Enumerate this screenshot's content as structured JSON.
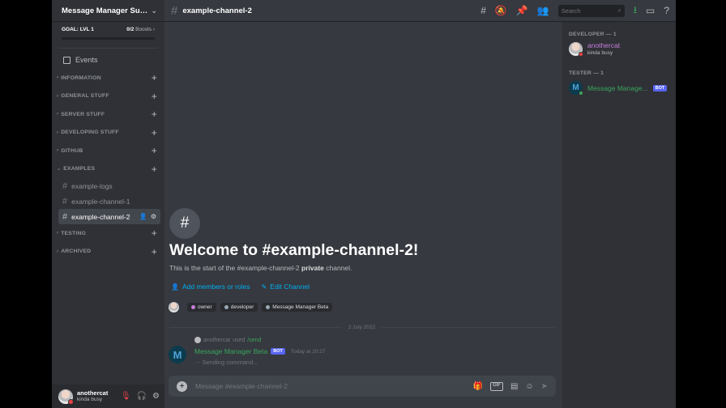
{
  "server": {
    "name": "Message Manager Supp...",
    "boost_goal": "GOAL: LVL 1",
    "boost_count": "0/2",
    "boost_word": "Boosts",
    "events_label": "Events"
  },
  "categories": [
    {
      "name": "INFORMATION"
    },
    {
      "name": "GENERAL STUFF"
    },
    {
      "name": "SERVER STUFF"
    },
    {
      "name": "DEVELOPING STUFF"
    },
    {
      "name": "GITHUB"
    },
    {
      "name": "EXAMPLES"
    },
    {
      "name": "TESTING"
    },
    {
      "name": "ARCHIVED"
    }
  ],
  "channels": [
    {
      "name": "example-logs"
    },
    {
      "name": "example-channel-1"
    },
    {
      "name": "example-channel-2"
    }
  ],
  "user": {
    "name": "anothercat",
    "status": "kinda busy"
  },
  "header": {
    "channel": "example-channel-2",
    "search_placeholder": "Search"
  },
  "welcome": {
    "title": "Welcome to #example-channel-2!",
    "sub_prefix": "This is the start of the #example-channel-2",
    "sub_bold": "private",
    "sub_suffix": "channel.",
    "add_members": "Add members or roles",
    "edit_channel": "Edit Channel",
    "roles": [
      "owner",
      "developer",
      "Message Manager Beta"
    ]
  },
  "date_divider": "2 July 2022",
  "message": {
    "ref_user": "anothercat",
    "ref_used": "used",
    "ref_cmd": "/send",
    "author": "Message Manager Beta",
    "bot_tag": "BOT",
    "time": "Today at 10:27",
    "body": "Sending command..."
  },
  "composer": {
    "placeholder": "Message #example-channel-2"
  },
  "members": {
    "groups": [
      {
        "title": "DEVELOPER — 1",
        "name": "anothercat",
        "status": "kinda busy"
      },
      {
        "title": "TESTER — 1",
        "name": "Message Manage...",
        "bot_tag": "BOT"
      }
    ]
  },
  "colors": {
    "accent": "#5865f2",
    "online": "#3ba55c",
    "dnd": "#ed4245",
    "link": "#00aff4"
  }
}
